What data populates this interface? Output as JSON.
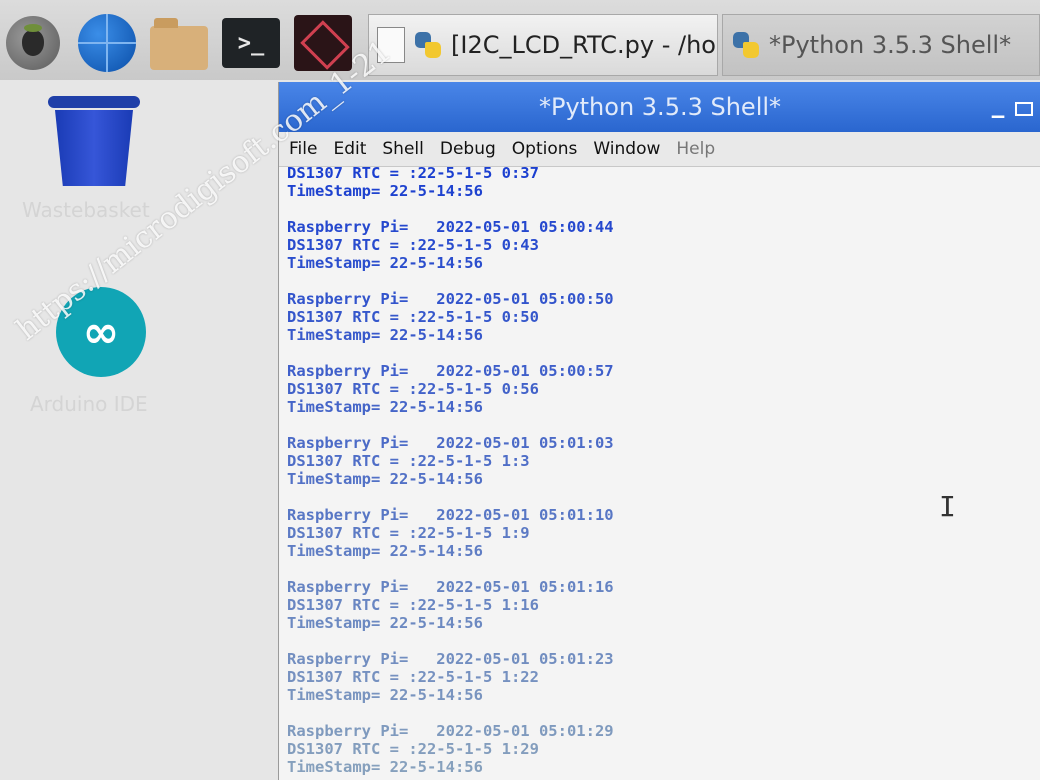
{
  "taskbar": {
    "launchers": [
      {
        "name": "raspberry-pi-menu",
        "icon": "raspberry-icon"
      },
      {
        "name": "web-browser",
        "icon": "globe-icon"
      },
      {
        "name": "file-manager",
        "icon": "folder-icon"
      },
      {
        "name": "terminal",
        "icon": "terminal-icon",
        "glyph": ">_"
      },
      {
        "name": "wolfram",
        "icon": "wolfram-icon"
      }
    ],
    "tasks": [
      {
        "label": "[I2C_LCD_RTC.py - /ho",
        "icon": "python-icon"
      },
      {
        "label": "*Python 3.5.3 Shell*",
        "icon": "python-icon"
      }
    ]
  },
  "desktop": {
    "trash_label": "Wastebasket",
    "arduino_label": "Arduino IDE",
    "watermark": "https://microdigisoft.com_1-21"
  },
  "window": {
    "title": "*Python 3.5.3 Shell*",
    "menu": [
      {
        "label": "File"
      },
      {
        "label": "Edit"
      },
      {
        "label": "Shell"
      },
      {
        "label": "Debug"
      },
      {
        "label": "Options"
      },
      {
        "label": "Window"
      },
      {
        "label": "Help"
      }
    ],
    "colors": {
      "titlebar": "#2a66cf",
      "text": "#1b3fd0"
    }
  },
  "shell": {
    "lines": [
      "DS1307 RTC = :22-5-1-5 0:37",
      "TimeStamp= 22-5-14:56",
      "",
      "Raspberry Pi=   2022-05-01 05:00:44",
      "DS1307 RTC = :22-5-1-5 0:43",
      "TimeStamp= 22-5-14:56",
      "",
      "Raspberry Pi=   2022-05-01 05:00:50",
      "DS1307 RTC = :22-5-1-5 0:50",
      "TimeStamp= 22-5-14:56",
      "",
      "Raspberry Pi=   2022-05-01 05:00:57",
      "DS1307 RTC = :22-5-1-5 0:56",
      "TimeStamp= 22-5-14:56",
      "",
      "Raspberry Pi=   2022-05-01 05:01:03",
      "DS1307 RTC = :22-5-1-5 1:3",
      "TimeStamp= 22-5-14:56",
      "",
      "Raspberry Pi=   2022-05-01 05:01:10",
      "DS1307 RTC = :22-5-1-5 1:9",
      "TimeStamp= 22-5-14:56",
      "",
      "Raspberry Pi=   2022-05-01 05:01:16",
      "DS1307 RTC = :22-5-1-5 1:16",
      "TimeStamp= 22-5-14:56",
      "",
      "Raspberry Pi=   2022-05-01 05:01:23",
      "DS1307 RTC = :22-5-1-5 1:22",
      "TimeStamp= 22-5-14:56",
      "",
      "Raspberry Pi=   2022-05-01 05:01:29",
      "DS1307 RTC = :22-5-1-5 1:29",
      "TimeStamp= 22-5-14:56"
    ]
  }
}
